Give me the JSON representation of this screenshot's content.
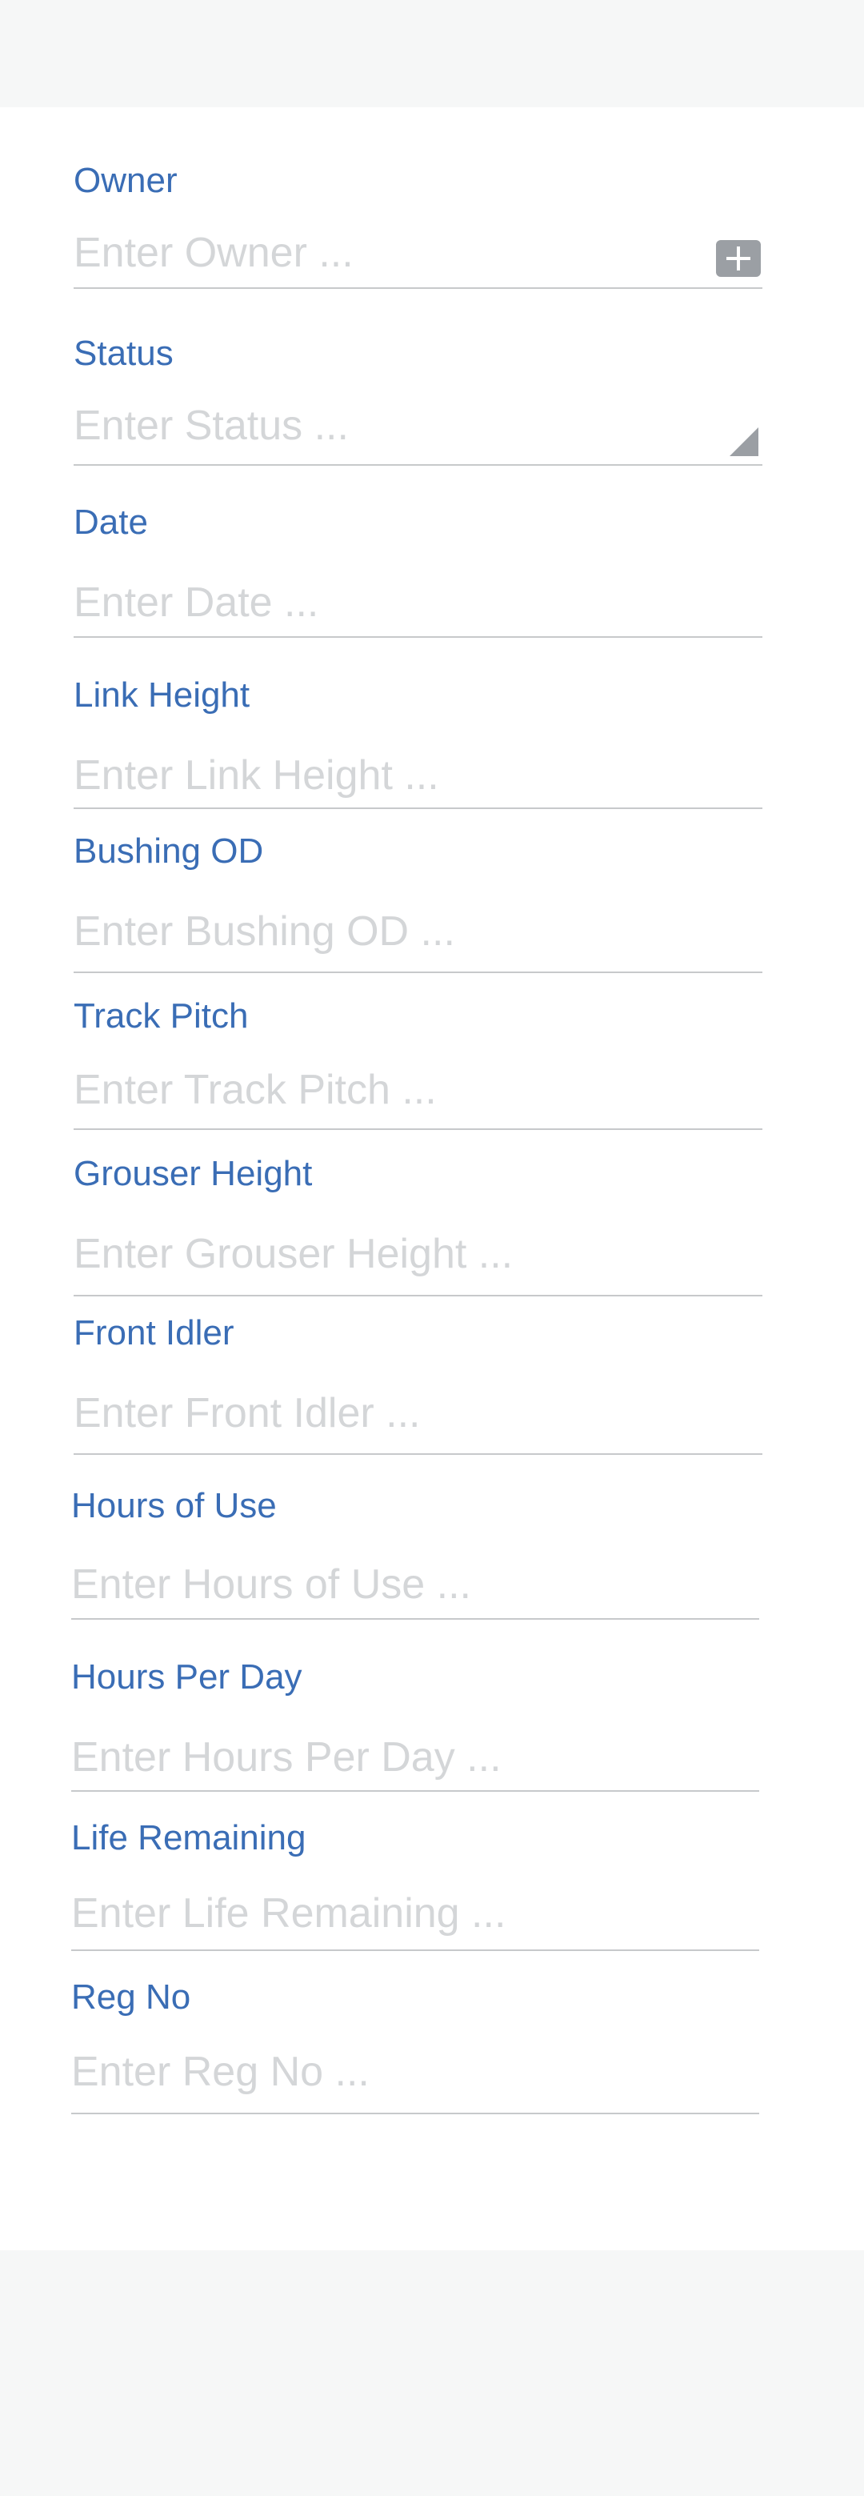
{
  "form": {
    "fields": [
      {
        "label": "Owner",
        "placeholder": "Enter Owner ...",
        "icon": "plus-icon"
      },
      {
        "label": "Status",
        "placeholder": "Enter Status ...",
        "icon": "dropdown-triangle-icon"
      },
      {
        "label": "Date",
        "placeholder": "Enter Date ..."
      },
      {
        "label": "Link Height",
        "placeholder": "Enter Link Height ..."
      },
      {
        "label": "Bushing OD",
        "placeholder": "Enter Bushing OD ..."
      },
      {
        "label": "Track Pitch",
        "placeholder": "Enter Track Pitch ..."
      },
      {
        "label": "Grouser Height",
        "placeholder": "Enter Grouser Height ..."
      },
      {
        "label": "Front Idler",
        "placeholder": "Enter Front Idler ..."
      },
      {
        "label": "Hours of Use",
        "placeholder": "Enter Hours of Use ..."
      },
      {
        "label": "Hours Per Day",
        "placeholder": "Enter Hours Per Day ..."
      },
      {
        "label": "Life Remaining",
        "placeholder": "Enter Life Remaining ..."
      },
      {
        "label": "Reg No",
        "placeholder": "Enter Reg No ..."
      }
    ]
  },
  "colors": {
    "label": "#3a6db5",
    "placeholder": "#d4d6d8",
    "underline": "#c7c9cb",
    "icon": "#9b9fa4",
    "page_background": "#f6f7f7",
    "card_background": "#ffffff"
  }
}
